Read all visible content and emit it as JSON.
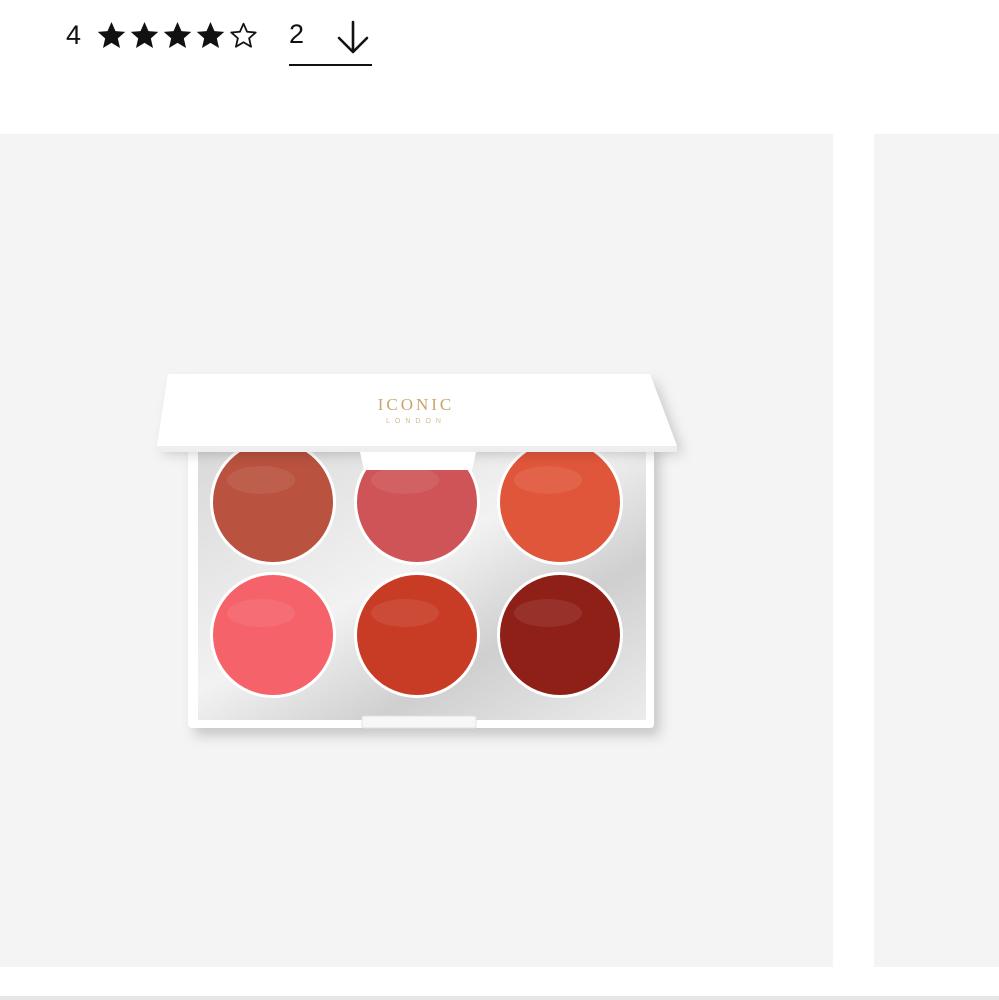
{
  "rating": {
    "value": "4",
    "stars_filled": 4,
    "stars_total": 5,
    "star_color": "#111111"
  },
  "reviews": {
    "count": "2",
    "icon": "arrow-down-icon"
  },
  "product_image": {
    "brand_text": "ICONIC",
    "brand_subtext": "LONDON",
    "pan_colors": [
      "#b9523f",
      "#cf5457",
      "#e0563b",
      "#f6626a",
      "#c83c26",
      "#8f2018"
    ]
  },
  "colors": {
    "background": "#ffffff",
    "gallery_bg": "#f4f4f4",
    "text": "#111111"
  }
}
